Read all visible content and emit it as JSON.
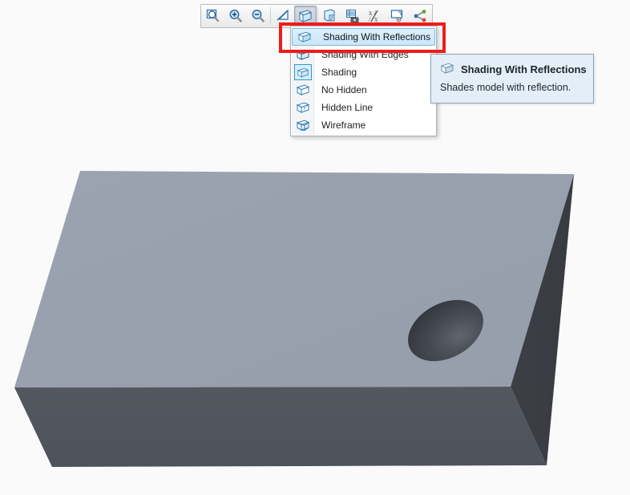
{
  "app": {
    "background_color": "#fafafa"
  },
  "toolbar": {
    "name": "view-toolbar",
    "buttons": [
      {
        "id": "zoom-window",
        "icon": "zoom-window-icon",
        "title": "Zoom Window",
        "active": false
      },
      {
        "id": "zoom-in",
        "icon": "zoom-in-icon",
        "title": "Zoom In",
        "active": false
      },
      {
        "id": "zoom-out",
        "icon": "zoom-out-icon",
        "title": "Zoom Out",
        "active": false
      },
      {
        "id": "pan",
        "icon": "pan-arrow-icon",
        "title": "Pan",
        "active": false
      },
      {
        "id": "display-style",
        "icon": "shaded-cube-icon",
        "title": "Display Style",
        "active": true
      },
      {
        "id": "appearance",
        "icon": "appearance-page-icon",
        "title": "Appearance",
        "active": false
      },
      {
        "id": "capture-image",
        "icon": "camera-capture-icon",
        "title": "Capture Image",
        "active": false
      },
      {
        "id": "measure",
        "icon": "measure-xy-icon",
        "title": "Measure",
        "active": false
      },
      {
        "id": "annotation-view",
        "icon": "annotation-view-icon",
        "title": "Annotation View",
        "active": false
      },
      {
        "id": "explode",
        "icon": "explode-node-icon",
        "title": "Explode",
        "active": false
      }
    ]
  },
  "style_menu": {
    "name": "display-style-menu",
    "items": [
      {
        "label": "Shading With Reflections",
        "icon": "cube-reflective-icon",
        "highlighted": true,
        "checked": false
      },
      {
        "label": "Shading With Edges",
        "icon": "cube-shaded-edges-icon",
        "highlighted": false,
        "checked": false
      },
      {
        "label": "Shading",
        "icon": "cube-shaded-icon",
        "highlighted": false,
        "checked": true
      },
      {
        "label": "No Hidden",
        "icon": "cube-no-hidden-icon",
        "highlighted": false,
        "checked": false
      },
      {
        "label": "Hidden Line",
        "icon": "cube-hidden-line-icon",
        "highlighted": false,
        "checked": false
      },
      {
        "label": "Wireframe",
        "icon": "cube-wireframe-icon",
        "highlighted": false,
        "checked": false
      }
    ]
  },
  "tooltip": {
    "name": "display-style-tooltip",
    "icon": "cube-reflective-icon",
    "title": "Shading With Reflections",
    "description": "Shades model with reflection."
  },
  "annotation": {
    "name": "red-highlight-rectangle",
    "color": "#ee1c1c",
    "target": "Shading With Reflections"
  },
  "model": {
    "name": "rectangular-block-with-hole",
    "colors": {
      "top_face": "#9aa1ae",
      "front_face": "#51565e",
      "right_face": "#3a3d43",
      "hole_dark": "#34373d",
      "hole_light": "#5d626b"
    }
  }
}
